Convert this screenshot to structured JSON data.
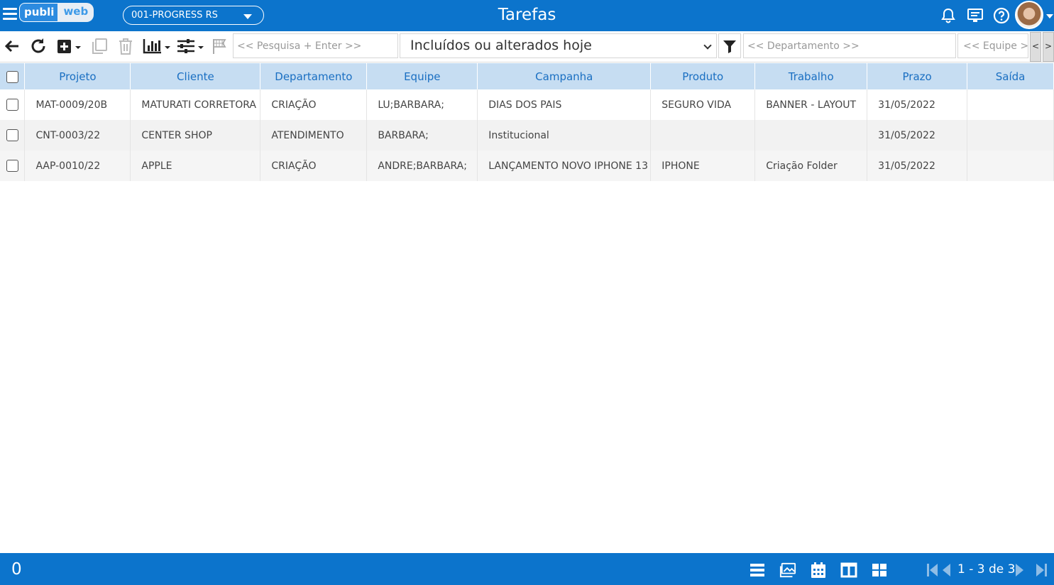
{
  "header": {
    "logo_part1": "publi",
    "logo_part2": "web",
    "company": "001-PROGRESS RS",
    "title": "Tarefas"
  },
  "toolbar": {
    "search_placeholder": "<< Pesquisa + Enter >>",
    "filter_selected": "Incluídos ou alterados hoje",
    "department_placeholder": "<< Departamento >>",
    "team_placeholder": "<< Equipe >>",
    "scroll_left": "<",
    "scroll_right": ">"
  },
  "table": {
    "columns": [
      "Projeto",
      "Cliente",
      "Departamento",
      "Equipe",
      "Campanha",
      "Produto",
      "Trabalho",
      "Prazo",
      "Saída"
    ],
    "rows": [
      [
        "MAT-0009/20B",
        "MATURATI CORRETORA",
        "CRIAÇÃO",
        "LU;BARBARA;",
        "DIAS DOS PAIS",
        "SEGURO VIDA",
        "BANNER - LAYOUT",
        "31/05/2022",
        ""
      ],
      [
        "CNT-0003/22",
        "CENTER SHOP",
        "ATENDIMENTO",
        "BARBARA;",
        "Institucional",
        "",
        "",
        "31/05/2022",
        ""
      ],
      [
        "AAP-0010/22",
        "APPLE",
        "CRIAÇÃO",
        "ANDRE;BARBARA;",
        "LANÇAMENTO NOVO IPHONE 13",
        "IPHONE",
        "Criação Folder",
        "31/05/2022",
        ""
      ]
    ]
  },
  "footer": {
    "selected_count": "0",
    "pagination": "1 - 3 de 3"
  },
  "colors": {
    "primary": "#0c74cc",
    "header_row": "#c6ddf2",
    "header_text": "#1a6fc2"
  }
}
